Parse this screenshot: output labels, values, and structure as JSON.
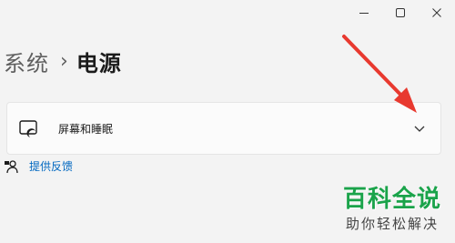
{
  "window": {
    "minimize_icon": "minimize-icon",
    "maximize_icon": "maximize-icon"
  },
  "breadcrumb": {
    "parent": "系统",
    "separator": "›",
    "current": "电源"
  },
  "card": {
    "label": "屏幕和睡眠",
    "icon": "screen-sleep-icon",
    "expander_icon": "chevron-down-icon"
  },
  "feedback": {
    "label": "提供反馈",
    "icon": "feedback-person-icon"
  },
  "annotation": {
    "arrow_color": "#e8392f"
  },
  "watermark": {
    "title": "百科全说",
    "subtitle": "助你轻松解决"
  },
  "colors": {
    "background": "#f3f3f3",
    "card": "#fbfbfb",
    "link": "#0067c0",
    "watermark": "#1aa34a"
  }
}
